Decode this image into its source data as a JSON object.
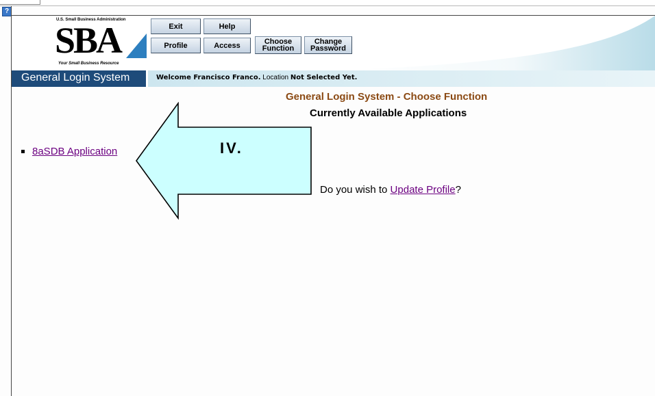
{
  "header": {
    "agency_line": "U.S. Small Business Administration",
    "logo_text": "SBA",
    "tagline": "Your Small Business Resource",
    "buttons": {
      "exit": "Exit",
      "help": "Help",
      "profile": "Profile",
      "access": "Access",
      "choose_function": [
        "Choose",
        "Function"
      ],
      "change_password": [
        "Change",
        "Password"
      ]
    }
  },
  "titlebar": {
    "system_name": "General Login System",
    "welcome_prefix": "Welcome Francisco Franco.",
    "location_label": " Location ",
    "location_value": "Not Selected Yet."
  },
  "main": {
    "page_title": "General Login System - Choose Function",
    "subtitle": "Currently Available Applications",
    "applications": [
      {
        "label": "8aSDB Application"
      }
    ],
    "annotation_label": "IV.",
    "update_prompt_prefix": "Do you wish to ",
    "update_profile_link": "Update Profile",
    "update_prompt_suffix": "?"
  },
  "icons": {
    "help": "?"
  },
  "colors": {
    "titlebar_bg": "#1e4b7a",
    "page_title": "#8b4a14",
    "link": "#6b0080",
    "arrow_fill": "#ccffff"
  }
}
